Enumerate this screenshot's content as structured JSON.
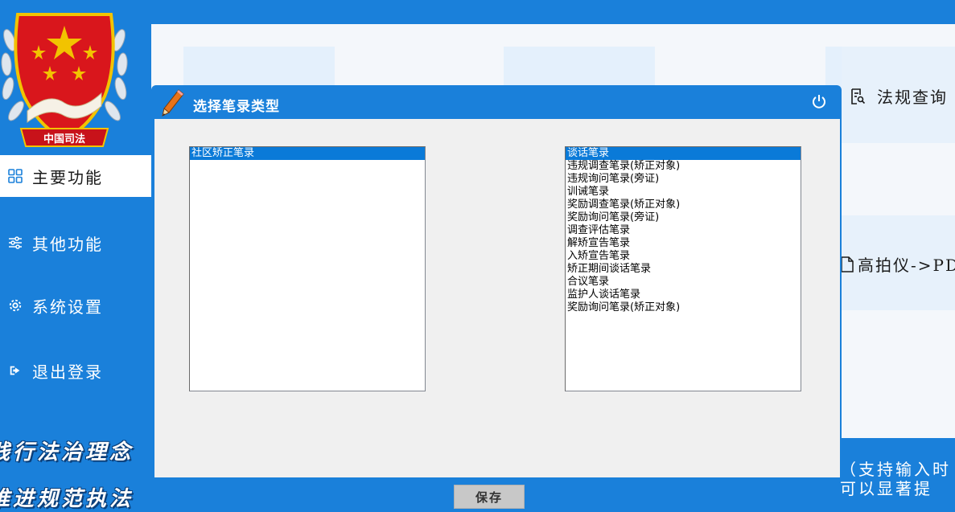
{
  "sidebar": {
    "emblem_text": "中国司法",
    "items": [
      {
        "label": "主要功能",
        "icon": "grid-icon",
        "active": true
      },
      {
        "label": "其他功能",
        "icon": "sliders-icon",
        "active": false
      },
      {
        "label": "系统设置",
        "icon": "gear-icon",
        "active": false
      },
      {
        "label": "退出登录",
        "icon": "logout-icon",
        "active": false
      }
    ],
    "slogans": [
      "践行法治理念",
      "推进规范执法"
    ]
  },
  "main": {
    "links": [
      {
        "label": "法规查询",
        "icon": "document-search-icon"
      },
      {
        "label": "高拍仪->PDF",
        "icon": "file-icon"
      }
    ],
    "hint_lines": [
      "（支持输入时",
      "可以显著提"
    ]
  },
  "dialog": {
    "title": "选择笔录类型",
    "left_list": [
      "社区矫正笔录"
    ],
    "right_list": [
      "谈话笔录",
      "违规调查笔录(矫正对象)",
      "违规询问笔录(旁证)",
      "训诫笔录",
      "奖励调查笔录(矫正对象)",
      "奖励询问笔录(旁证)",
      "调查评估笔录",
      "解矫宣告笔录",
      "入矫宣告笔录",
      "矫正期间谈话笔录",
      "合议笔录",
      "监护人谈话笔录",
      "奖励询问笔录(矫正对象)"
    ],
    "save_label": "保存"
  },
  "colors": {
    "primary": "#1a80da",
    "selection": "#0a7ad8",
    "emblem_red": "#d9161c",
    "emblem_gold": "#f2c300"
  }
}
